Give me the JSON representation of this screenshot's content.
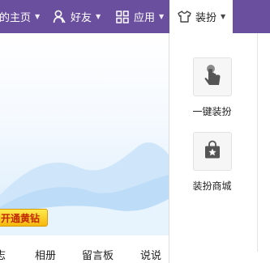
{
  "nav": {
    "home_label": "的主页",
    "friends_label": "好友",
    "apps_label": "应用",
    "dress_label": "装扮",
    "friends_icon": "person-icon",
    "apps_icon": "grid-icon",
    "dress_icon": "tshirt-icon",
    "bar_color": "#6b4f9f"
  },
  "page": {
    "vip_button_label": "开通黄钻",
    "tabs": [
      "志",
      "相册",
      "留言板",
      "说说"
    ]
  },
  "dropdown": {
    "items": [
      {
        "label": "一键装扮",
        "icon": "hand-tap-icon"
      },
      {
        "label": "装扮商城",
        "icon": "shopping-bag-star-icon"
      }
    ]
  }
}
